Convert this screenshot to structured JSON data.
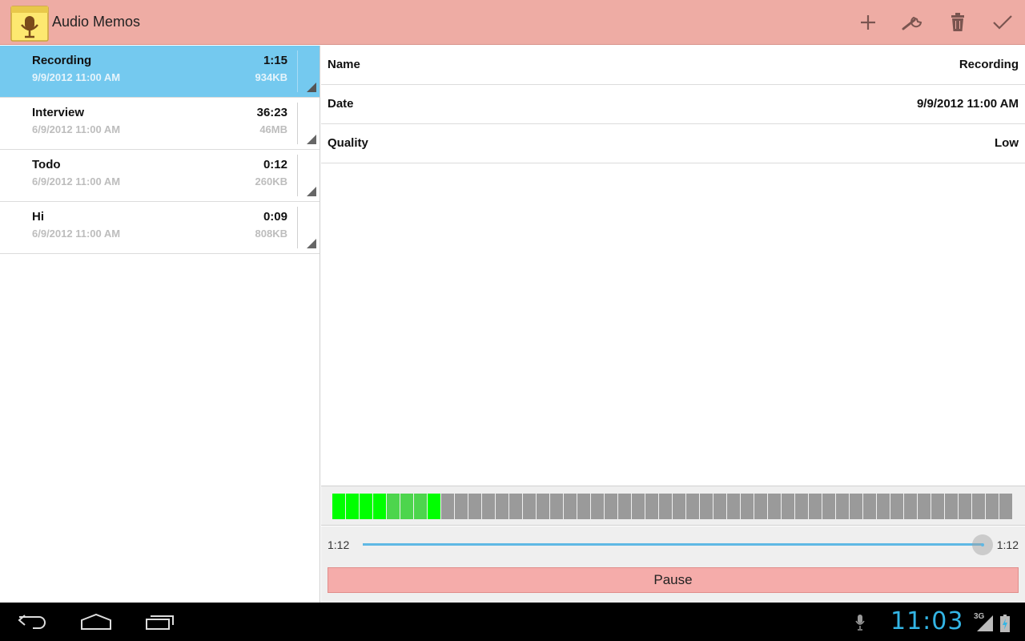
{
  "app": {
    "title": "Audio Memos",
    "icon": "microphone-notepad-icon"
  },
  "actions": [
    {
      "name": "add-button",
      "icon": "plus-icon"
    },
    {
      "name": "settings-button",
      "icon": "wrench-icon"
    },
    {
      "name": "delete-button",
      "icon": "trash-icon"
    },
    {
      "name": "done-button",
      "icon": "checkmark-icon"
    }
  ],
  "recordings": [
    {
      "name": "Recording",
      "date": "9/9/2012 11:00 AM",
      "duration": "1:15",
      "size": "934KB",
      "selected": true
    },
    {
      "name": "Interview",
      "date": "6/9/2012 11:00 AM",
      "duration": "36:23",
      "size": "46MB",
      "selected": false
    },
    {
      "name": "Todo",
      "date": "6/9/2012 11:00 AM",
      "duration": "0:12",
      "size": "260KB",
      "selected": false
    },
    {
      "name": "Hi",
      "date": "6/9/2012 11:00 AM",
      "duration": "0:09",
      "size": "808KB",
      "selected": false
    }
  ],
  "details": [
    {
      "label": "Name",
      "value": "Recording"
    },
    {
      "label": "Date",
      "value": "9/9/2012 11:00 AM"
    },
    {
      "label": "Quality",
      "value": "Low"
    }
  ],
  "meter": {
    "total_segments": 50,
    "active_segments": 8
  },
  "player": {
    "elapsed": "1:12",
    "total": "1:12",
    "progress": 1.0,
    "button_label": "Pause"
  },
  "status_bar": {
    "time": "11:03",
    "network": "3G"
  },
  "colors": {
    "action_bar": "#eeaca4",
    "selection": "#74c9ef",
    "meter_on": "#00ff00",
    "clock": "#33b5e5",
    "pause_button": "#f5acaa"
  }
}
